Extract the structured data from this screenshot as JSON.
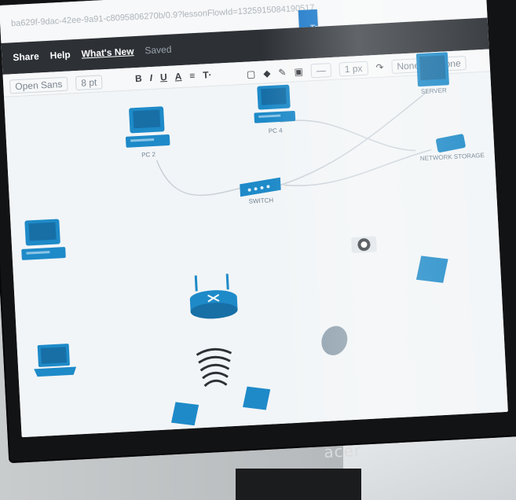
{
  "browser": {
    "url_fragment": "ba629f-9dac-42ee-9a91-c8095806270b/0.9?lessonFlowId=1325915084190517",
    "trial_button": "Try paid features free!",
    "trial_close_icon": "close-icon"
  },
  "menu": {
    "items": [
      "Share",
      "Help",
      "What's New"
    ],
    "status": "Saved"
  },
  "toolbar": {
    "font": "Open Sans",
    "font_size": "8 pt",
    "bold": "B",
    "italic": "I",
    "underline": "U",
    "font_color": "A",
    "align": "≡",
    "text_style": "T·",
    "line_style": "—",
    "line_width": "1 px",
    "arrow_start": "None",
    "arrow_end": "None"
  },
  "diagram": {
    "nodes": [
      {
        "label": "PC 2",
        "icon": "desktop-pc-icon"
      },
      {
        "label": "PC 4",
        "icon": "desktop-pc-icon"
      },
      {
        "label": "SERVER",
        "icon": "server-icon"
      },
      {
        "label": "SWITCH",
        "icon": "switch-icon"
      },
      {
        "label": "NETWORK STORAGE",
        "icon": "network-storage-icon"
      },
      {
        "label": "",
        "icon": "desktop-pc-icon"
      },
      {
        "label": "",
        "icon": "camera-icon"
      },
      {
        "label": "",
        "icon": "router-icon"
      },
      {
        "label": "",
        "icon": "laptop-icon"
      },
      {
        "label": "",
        "icon": "wireless-signal-icon"
      },
      {
        "label": "",
        "icon": "mouse-icon"
      },
      {
        "label": "",
        "icon": "tablet-icon"
      },
      {
        "label": "",
        "icon": "tablet-icon"
      },
      {
        "label": "",
        "icon": "tablet-icon"
      }
    ]
  },
  "monitor": {
    "brand": "acer"
  },
  "colors": {
    "device_blue": "#1e8ac8",
    "topbar": "#2d3136",
    "trial_button": "#1a78c9"
  }
}
